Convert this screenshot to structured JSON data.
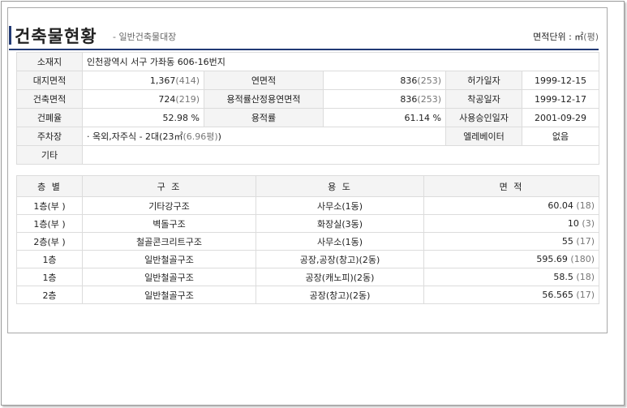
{
  "header": {
    "title": "건축물현황",
    "subtitle": "- 일반건축물대장",
    "unit_label": "면적단위 : ㎡",
    "unit_paren": "(평)"
  },
  "info": {
    "location_label": "소재지",
    "location_value": "인천광역시 서구 가좌동 606-16번지",
    "land_area_label": "대지면적",
    "land_area_value": "1,367",
    "land_area_pyeong": "(414)",
    "total_floor_label": "연면적",
    "total_floor_value": "836",
    "total_floor_pyeong": "(253)",
    "permit_date_label": "허가일자",
    "permit_date_value": "1999-12-15",
    "building_area_label": "건축면적",
    "building_area_value": "724",
    "building_area_pyeong": "(219)",
    "far_area_label": "용적률산정용연면적",
    "far_area_value": "836",
    "far_area_pyeong": "(253)",
    "start_date_label": "착공일자",
    "start_date_value": "1999-12-17",
    "coverage_label": "건폐율",
    "coverage_value": "52.98 %",
    "far_label": "용적률",
    "far_value": "61.14 %",
    "approval_date_label": "사용승인일자",
    "approval_date_value": "2001-09-29",
    "parking_label": "주차장",
    "parking_value": "· 옥외,자주식 - 2대(23㎡",
    "parking_pyeong": "(6.96평)",
    "parking_close": ")",
    "elevator_label": "엘레베이터",
    "elevator_value": "없음",
    "other_label": "기타",
    "other_value": ""
  },
  "floors": {
    "headers": [
      "층 별",
      "구  조",
      "용  도",
      "면 적"
    ],
    "rows": [
      {
        "floor": "1층(부 )",
        "structure": "기타강구조",
        "usage": "사무소(1동)",
        "area": "60.04",
        "pyeong": "(18)"
      },
      {
        "floor": "1층(부 )",
        "structure": "벽돌구조",
        "usage": "화장실(3동)",
        "area": "10",
        "pyeong": "(3)"
      },
      {
        "floor": "2층(부 )",
        "structure": "철골콘크리트구조",
        "usage": "사무소(1동)",
        "area": "55",
        "pyeong": "(17)"
      },
      {
        "floor": "1층",
        "structure": "일반철골구조",
        "usage": "공장,공장(창고)(2동)",
        "area": "595.69",
        "pyeong": "(180)"
      },
      {
        "floor": "1층",
        "structure": "일반철골구조",
        "usage": "공장(캐노피)(2동)",
        "area": "58.5",
        "pyeong": "(18)"
      },
      {
        "floor": "2층",
        "structure": "일반철골구조",
        "usage": "공장(창고)(2동)",
        "area": "56.565",
        "pyeong": "(17)"
      }
    ]
  }
}
